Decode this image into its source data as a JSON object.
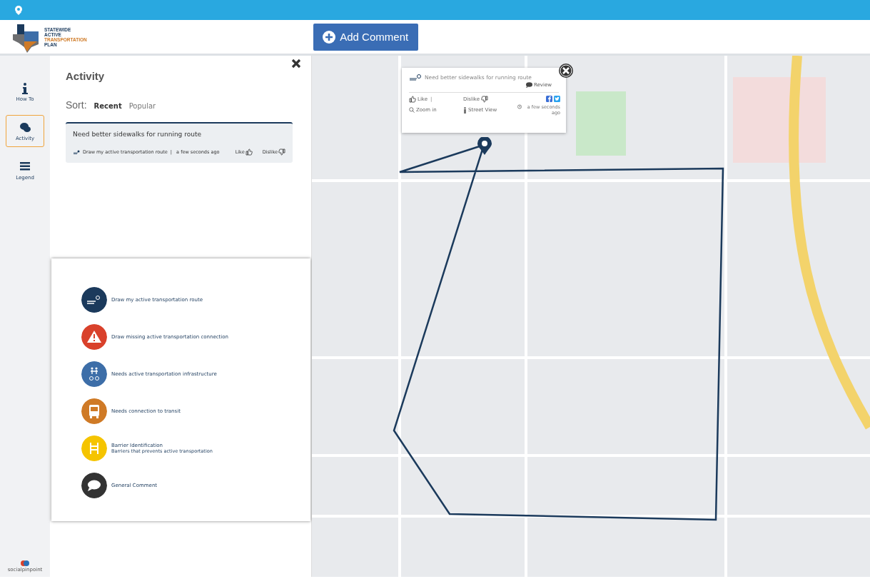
{
  "header": {
    "logo_lines": [
      "STATEWIDE",
      "ACTIVE",
      "TRANSPORTATION",
      "PLAN"
    ],
    "add_button": "Add Comment"
  },
  "sidebar": {
    "items": [
      {
        "label": "How To",
        "kind": "info",
        "selected": false
      },
      {
        "label": "Activity",
        "kind": "comments",
        "selected": true
      },
      {
        "label": "Legend",
        "kind": "list",
        "selected": false
      }
    ],
    "footer": "socialpinpoint"
  },
  "activity": {
    "title": "Activity",
    "sort_label": "Sort:",
    "sort_tabs": [
      {
        "label": "Recent",
        "selected": true
      },
      {
        "label": "Popular",
        "selected": false
      }
    ],
    "cards": [
      {
        "text": "Need better sidewalks for running route",
        "category": "Draw my active transportation route",
        "separator": "|",
        "time": "a few seconds ago",
        "like": "Like",
        "dislike": "Dislike"
      }
    ]
  },
  "legend": {
    "items": [
      {
        "kind": "route",
        "color": "#1b3a5c",
        "label": "Draw my active transportation route"
      },
      {
        "kind": "warning",
        "color": "#d9412b",
        "label": "Draw missing active transportation connection"
      },
      {
        "kind": "walk",
        "color": "#3d6ea8",
        "label": "Needs active transportation infrastructure"
      },
      {
        "kind": "bus",
        "color": "#cf7a26",
        "label": "Needs connection to transit"
      },
      {
        "kind": "barrier",
        "color": "#f5c400",
        "label": "Barrier Identification",
        "sublabel": "Barriers that prevents active transportation"
      },
      {
        "kind": "comment",
        "color": "#333333",
        "label": "General Comment"
      }
    ]
  },
  "popup": {
    "text": "Need better sidewalks for running route",
    "review": "Review",
    "like": "Like",
    "separator": "|",
    "dislike": "Dislike",
    "zoom": "Zoom in",
    "street_view": "Street View",
    "time": "a few seconds ago"
  }
}
